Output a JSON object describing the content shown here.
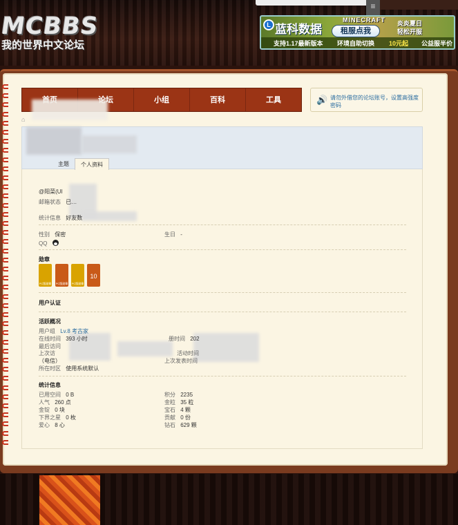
{
  "header": {
    "logo_text": "MCBBS",
    "logo_subtitle": "我的世界中文论坛",
    "ad": {
      "brand": "蓝科数据",
      "badge": "MINECRAFT",
      "button": "租服点我",
      "promo_line1": "炎炎夏日",
      "promo_line2": "轻松开服",
      "bottom1": "支持1.17最新版本",
      "bottom2": "环境自助切换",
      "bottom3": "10元起",
      "bottom4": "公益服半价"
    }
  },
  "nav": {
    "items": [
      "首页",
      "论坛",
      "小组",
      "百科",
      "工具"
    ]
  },
  "notice": {
    "text": "请勿外借您的论坛账号，设置高强度密码"
  },
  "tabs": [
    "主题",
    "个人资料"
  ],
  "profile": {
    "username_prefix": "@阳菜(UI",
    "email_label": "邮箱状态",
    "email_value": "已…",
    "stats_label": "统计信息",
    "stats_value": "好友数",
    "gender_label": "性别",
    "gender_value": "保密",
    "birthday_label": "生日",
    "birthday_value": "-",
    "qq_label": "QQ",
    "medals_heading": "勋章",
    "medals": [
      {
        "color": "#e6b800",
        "text": "PC版勋章"
      },
      {
        "color": "#c95a18",
        "text": "PC版勋章"
      },
      {
        "color": "#e6b800",
        "text": "PC版勋章"
      },
      {
        "color": "#c95a18",
        "text": "10"
      }
    ],
    "auth_heading": "用户认证",
    "activity_heading": "活跃概况",
    "user_group_label": "用户组",
    "user_group_value": "Lv.8 考古家",
    "online_label": "在线时间",
    "online_value": "393 小时",
    "last_visit_label": "最后访问",
    "last_activity_label": "上次访",
    "telecom": "（电信）",
    "timezone_label": "所在时区",
    "timezone_value": "使用系统默认",
    "register_label": "册时间",
    "register_value": "202",
    "last_active_label": "活动时间",
    "last_post_label": "上次发表时间",
    "points_heading": "统计信息",
    "left_stats": [
      {
        "label": "已用空间",
        "value": "0 B"
      },
      {
        "label": "人气",
        "value": "260 点"
      },
      {
        "label": "金锭",
        "value": "0 块"
      },
      {
        "label": "下界之星",
        "value": "0 枚"
      },
      {
        "label": "爱心",
        "value": "8 心"
      }
    ],
    "right_stats": [
      {
        "label": "积分",
        "value": "2235"
      },
      {
        "label": "金粒",
        "value": "35 粒"
      },
      {
        "label": "宝石",
        "value": "4 颗"
      },
      {
        "label": "贡献",
        "value": "0 份"
      },
      {
        "label": "钻石",
        "value": "629 颗"
      }
    ]
  }
}
